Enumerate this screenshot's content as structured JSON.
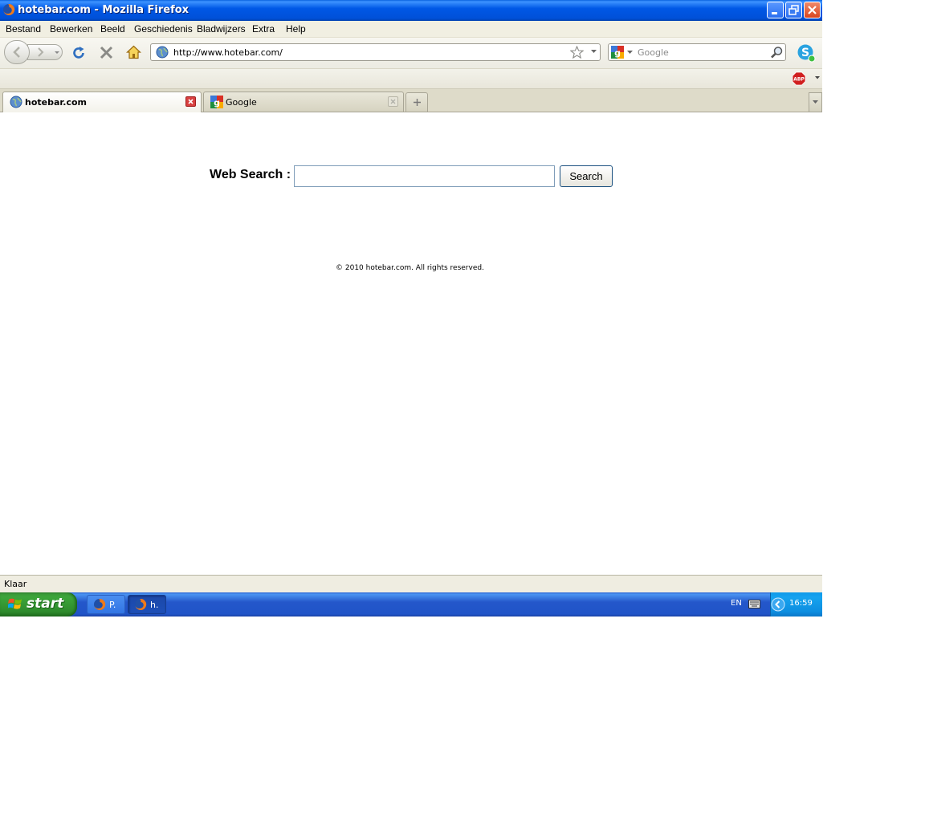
{
  "window": {
    "title": "hotebar.com - Mozilla Firefox"
  },
  "menu": [
    "Bestand",
    "Bewerken",
    "Beeld",
    "Geschiedenis",
    "Bladwijzers",
    "Extra",
    "Help"
  ],
  "navbar": {
    "url": "http://www.hotebar.com/",
    "search_placeholder": "Google"
  },
  "addons": {
    "abp_label": "ABP"
  },
  "tabs": [
    {
      "label": "hotebar.com",
      "active": true
    },
    {
      "label": "Google",
      "active": false
    }
  ],
  "page": {
    "search_label": "Web Search :",
    "search_button": "Search",
    "search_value": "",
    "copyright": "© 2010 hotebar.com. All rights reserved."
  },
  "status": {
    "text": "Klaar"
  },
  "taskbar": {
    "start_label": "start",
    "tasks": [
      {
        "label": "P."
      },
      {
        "label": "h."
      }
    ],
    "language": "EN",
    "clock": "16:59"
  },
  "icons": {
    "back": "back-arrow-icon",
    "forward": "forward-arrow-icon",
    "reload": "reload-icon",
    "stop": "stop-icon",
    "home": "home-icon",
    "bookmark_star": "star-icon",
    "search_magnifier": "magnifier-icon",
    "skype": "skype-icon"
  },
  "colors": {
    "titlebar": "#0058e6",
    "taskbar": "#2457ca",
    "start_button": "#3ca53a",
    "close_button": "#d8451f",
    "tray": "#0f99ea"
  }
}
